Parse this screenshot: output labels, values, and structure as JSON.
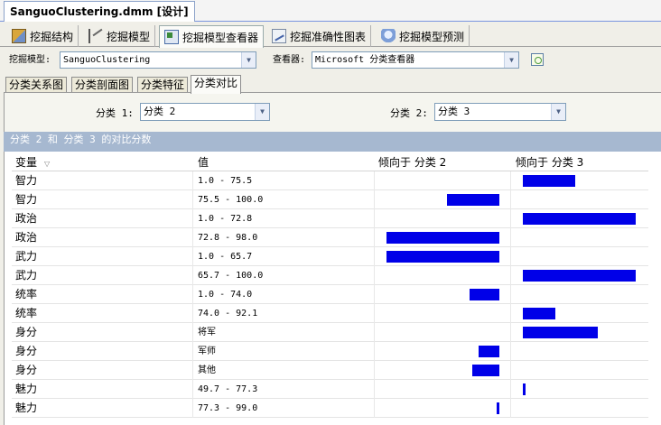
{
  "document_tab": {
    "title": "SanguoClustering.dmm [设计]"
  },
  "designer_tabs": [
    {
      "label": "挖掘结构",
      "icon": "mining-structure-icon",
      "active": false
    },
    {
      "label": "挖掘模型",
      "icon": "mining-models-icon",
      "active": false
    },
    {
      "label": "挖掘模型查看器",
      "icon": "mining-model-viewer-icon",
      "active": true
    },
    {
      "label": "挖掘准确性图表",
      "icon": "lift-chart-icon",
      "active": false
    },
    {
      "label": "挖掘模型预测",
      "icon": "prediction-diamond-icon",
      "active": false
    }
  ],
  "selectors": {
    "model_label": "挖掘模型:",
    "model_value": "SanguoClustering",
    "viewer_label": "查看器:",
    "viewer_value": "Microsoft 分类查看器",
    "refresh_icon": "refresh-icon"
  },
  "sub_tabs": [
    {
      "label": "分类关系图",
      "active": false
    },
    {
      "label": "分类剖面图",
      "active": false
    },
    {
      "label": "分类特征",
      "active": false
    },
    {
      "label": "分类对比",
      "active": true
    }
  ],
  "cluster_selectors": {
    "cluster1_label": "分类 1:",
    "cluster1_value": "分类 2",
    "cluster2_label": "分类 2:",
    "cluster2_value": "分类 3"
  },
  "comparison_header": "分类 2 和 分类 3 的对比分数",
  "table": {
    "columns": [
      "变量",
      "值",
      "倾向于 分类 2",
      "倾向于 分类 3"
    ],
    "sort_icon": "sort-down-icon",
    "bar_color": "#0000e8",
    "rows": [
      {
        "variable": "智力",
        "value": "1.0 - 75.5",
        "favors_cluster": 3,
        "score": 0.46
      },
      {
        "variable": "智力",
        "value": "75.5 - 100.0",
        "favors_cluster": 2,
        "score": 0.46
      },
      {
        "variable": "政治",
        "value": "1.0 - 72.8",
        "favors_cluster": 3,
        "score": 1.0
      },
      {
        "variable": "政治",
        "value": "72.8 - 98.0",
        "favors_cluster": 2,
        "score": 1.0
      },
      {
        "variable": "武力",
        "value": "1.0 - 65.7",
        "favors_cluster": 2,
        "score": 1.0
      },
      {
        "variable": "武力",
        "value": "65.7 - 100.0",
        "favors_cluster": 3,
        "score": 1.0
      },
      {
        "variable": "统率",
        "value": "1.0 - 74.0",
        "favors_cluster": 2,
        "score": 0.26
      },
      {
        "variable": "统率",
        "value": "74.0 - 92.1",
        "favors_cluster": 3,
        "score": 0.29
      },
      {
        "variable": "身分",
        "value": "将军",
        "favors_cluster": 3,
        "score": 0.66
      },
      {
        "variable": "身分",
        "value": "军师",
        "favors_cluster": 2,
        "score": 0.18
      },
      {
        "variable": "身分",
        "value": "其他",
        "favors_cluster": 2,
        "score": 0.24
      },
      {
        "variable": "魅力",
        "value": "49.7 - 77.3",
        "favors_cluster": 3,
        "score": 0.02
      },
      {
        "variable": "魅力",
        "value": "77.3 - 99.0",
        "favors_cluster": 2,
        "score": 0.02
      }
    ]
  }
}
